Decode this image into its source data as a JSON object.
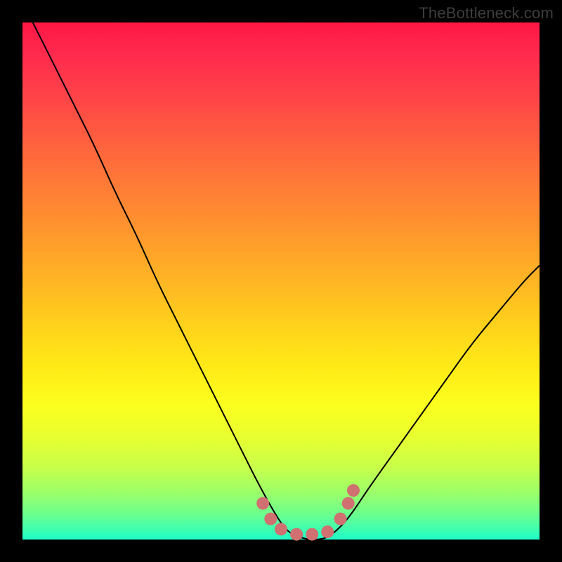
{
  "watermark": "TheBottleneck.com",
  "chart_data": {
    "type": "line",
    "title": "",
    "xlabel": "",
    "ylabel": "",
    "xlim": [
      0,
      1
    ],
    "ylim": [
      0,
      1
    ],
    "series": [
      {
        "name": "curve",
        "x": [
          0.02,
          0.06,
          0.1,
          0.14,
          0.18,
          0.22,
          0.26,
          0.3,
          0.34,
          0.38,
          0.42,
          0.46,
          0.5,
          0.52,
          0.55,
          0.58,
          0.6,
          0.63,
          0.67,
          0.72,
          0.77,
          0.82,
          0.87,
          0.92,
          0.97,
          1.0
        ],
        "y": [
          1.0,
          0.92,
          0.84,
          0.76,
          0.67,
          0.59,
          0.5,
          0.42,
          0.34,
          0.26,
          0.18,
          0.1,
          0.03,
          0.01,
          0.0,
          0.0,
          0.01,
          0.04,
          0.1,
          0.17,
          0.24,
          0.31,
          0.38,
          0.44,
          0.5,
          0.53
        ]
      }
    ],
    "markers": {
      "name": "highlight-dots",
      "color": "#d07070",
      "x": [
        0.465,
        0.48,
        0.5,
        0.53,
        0.56,
        0.59,
        0.615,
        0.63,
        0.64
      ],
      "y": [
        0.07,
        0.04,
        0.02,
        0.01,
        0.01,
        0.015,
        0.04,
        0.07,
        0.095
      ]
    }
  }
}
